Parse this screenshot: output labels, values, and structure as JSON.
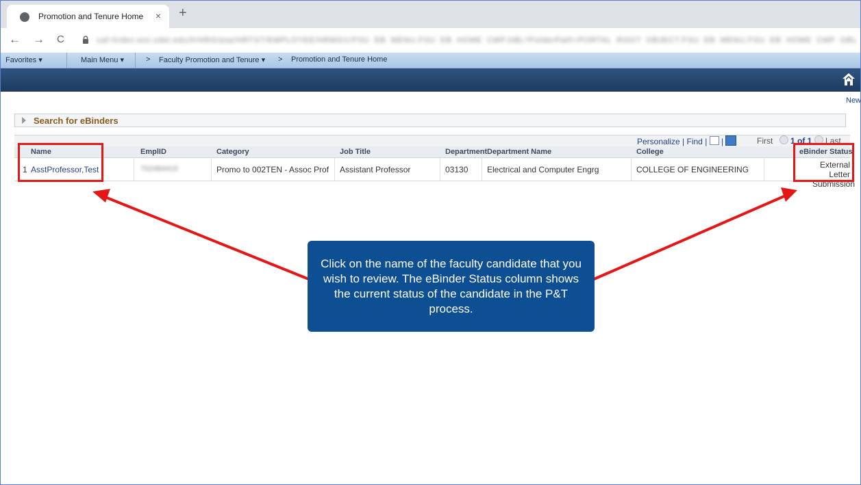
{
  "browser": {
    "tab_title": "Promotion and Tenure Home",
    "tab_close": "×",
    "new_tab": "+",
    "back": "←",
    "forward": "→",
    "reload": "C",
    "url_blurred": "uaf-hrdev.sso.udel.edu/#/HRG/psp/HRTST/EMPLOYEE/HRMS/c/FSU_EB_MENU.FSU_EB_HOME_CMP.GBL?FolderPath=PORTAL_ROOT_OBJECT.FSU_EB_MENU.FSU_EB_HOME_CMP_GBL&IsFolder=false"
  },
  "psnav": {
    "favorites": "Favorites ▾",
    "main_menu": "Main Menu ▾",
    "sep1": ">",
    "faculty": "Faculty Promotion and Tenure ▾",
    "sep2": ">",
    "current": "Promotion and Tenure Home"
  },
  "header": {
    "new_link": "New"
  },
  "search": {
    "label": "Search for eBinders"
  },
  "grid": {
    "tools": {
      "personalize": "Personalize",
      "sep": "|",
      "find": "Find"
    },
    "pager": {
      "first": "First",
      "range": "1 of 1",
      "last": "Last"
    },
    "columns": [
      "Name",
      "EmplID",
      "Category",
      "Job Title",
      "Department",
      "Department Name",
      "College",
      "eBinder Status"
    ],
    "rows": [
      {
        "num": "1",
        "name": "AsstProfessor,Test",
        "emplid": "702484415",
        "category": "Promo to 002TEN - Assoc Prof",
        "job_title": "Assistant Professor",
        "department": "03130",
        "department_name": "Electrical and Computer Engrg",
        "college": "COLLEGE OF ENGINEERING",
        "status_line1": "External Letter",
        "status_line2": "Submission"
      }
    ]
  },
  "callout": {
    "text": "Click on the name of the faculty candidate that you wish to review. The eBinder Status column shows the current status of the candidate in the P&T process."
  },
  "colors": {
    "annotation_red": "#e51616",
    "callout_blue": "#0e4f94",
    "banner_navy": "#1e3a5f",
    "link_blue": "#23408e",
    "search_label_brown": "#8a5a1c"
  },
  "icons": [
    "globe-icon",
    "lock-icon",
    "home-icon",
    "personalize-grid-icon",
    "download-excel-icon"
  ]
}
